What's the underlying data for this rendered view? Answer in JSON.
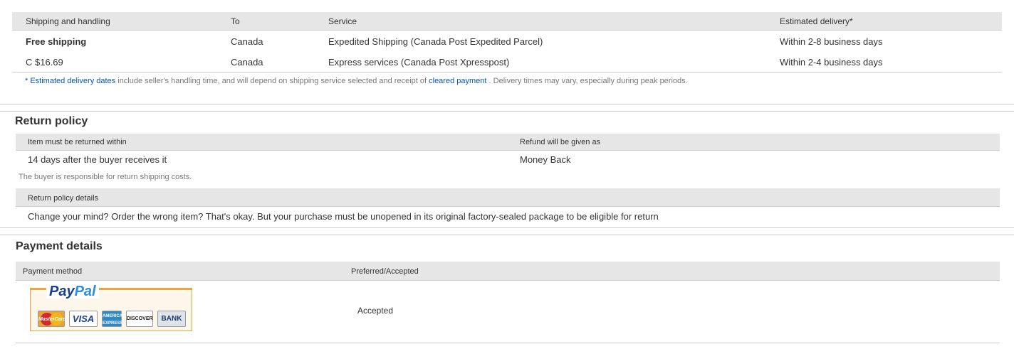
{
  "shipping": {
    "headers": [
      "Shipping and handling",
      "To",
      "Service",
      "Estimated delivery*"
    ],
    "rows": [
      {
        "cost": "Free shipping",
        "to": "Canada",
        "service": "Expedited Shipping (Canada Post Expedited Parcel)",
        "delivery": "Within 2-8 business days"
      },
      {
        "cost": "C $16.69",
        "to": "Canada",
        "service": "Express services (Canada Post Xpresspost)",
        "delivery": "Within 2-4 business days"
      }
    ],
    "note": {
      "asterisk": "*",
      "link1": "Estimated delivery dates",
      "text1": "include seller's handling time, and will depend on shipping service selected and receipt of",
      "link2": "cleared payment",
      "text2": ". Delivery times may vary, especially during peak periods."
    }
  },
  "return_policy": {
    "title": "Return policy",
    "headers": [
      "Item must be returned within",
      "Refund will be given as"
    ],
    "row": {
      "within": "14 days after the buyer receives it",
      "refund": "Money Back"
    },
    "shipping_note": "The buyer is responsible for return shipping costs.",
    "details_header": "Return policy details",
    "details_text": "Change your mind? Order the wrong item? That's okay. But your purchase must be unopened in its original factory-sealed package to be eligible for return"
  },
  "payment": {
    "title": "Payment details",
    "headers": [
      "Payment method",
      "Preferred/Accepted"
    ],
    "row": {
      "status": "Accepted"
    },
    "paypal": {
      "logo_part1": "Pay",
      "logo_part2": "Pal",
      "cards": [
        "MasterCard",
        "VISA",
        "AMERICAN EXPRESS",
        "DISCOVER",
        "BANK"
      ]
    }
  },
  "colors": {
    "header_bg": "#e6e6e6",
    "link": "#0654ba",
    "paypal_border": "#f0a33a"
  }
}
